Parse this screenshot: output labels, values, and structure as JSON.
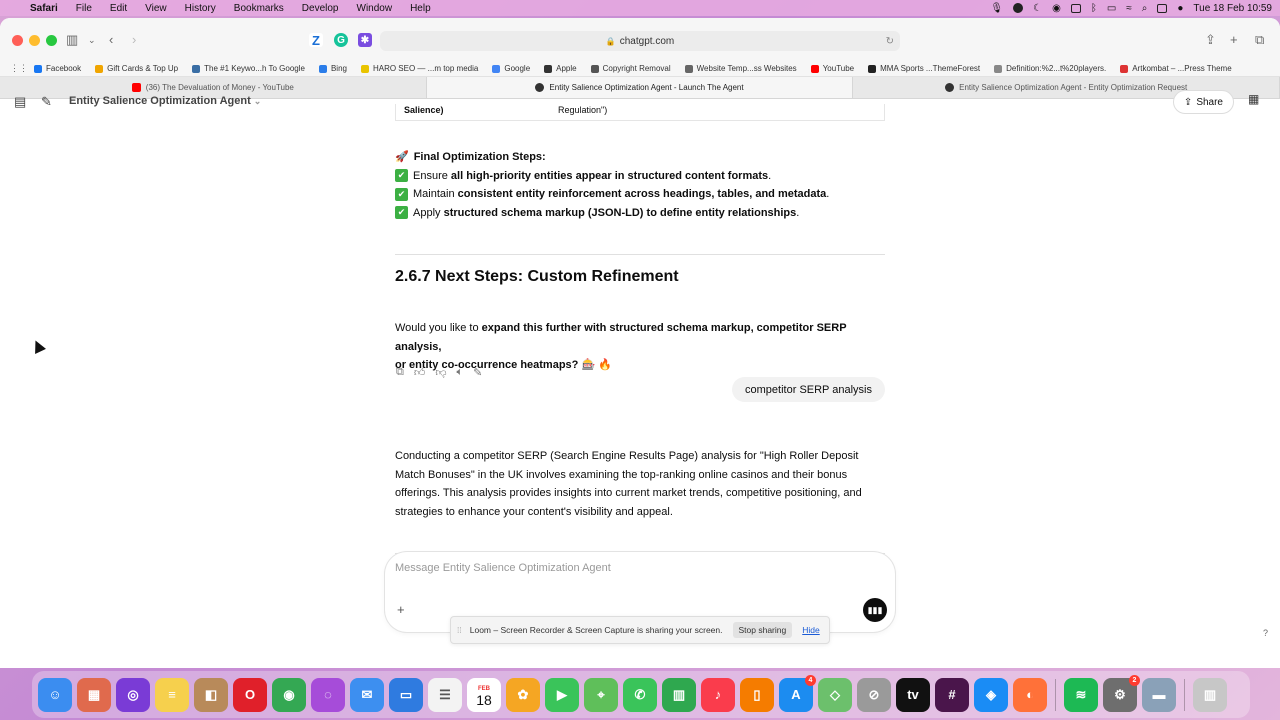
{
  "menubar": {
    "app": "Safari",
    "items": [
      "File",
      "Edit",
      "View",
      "History",
      "Bookmarks",
      "Develop",
      "Window",
      "Help"
    ],
    "clock": "Tue 18 Feb  10:59"
  },
  "browser": {
    "url": "chatgpt.com",
    "favorites": [
      {
        "label": "Facebook",
        "color": "#1877f2"
      },
      {
        "label": "Gift Cards & Top Up",
        "color": "#f0a500"
      },
      {
        "label": "The #1 Keywo...h To Google",
        "color": "#3a6ea5"
      },
      {
        "label": "Bing",
        "color": "#2b7de9"
      },
      {
        "label": "HARO SEO — ...m top media",
        "color": "#e9c400"
      },
      {
        "label": "Google",
        "color": "#4285f4"
      },
      {
        "label": "Apple",
        "color": "#333333"
      },
      {
        "label": "Copyright Removal",
        "color": "#555555"
      },
      {
        "label": "Website Temp...ss Websites",
        "color": "#666666"
      },
      {
        "label": "YouTube",
        "color": "#ff0000"
      },
      {
        "label": "MMA Sports ...ThemeForest",
        "color": "#222222"
      },
      {
        "label": "Definition:%2...t%20players.",
        "color": "#888888"
      },
      {
        "label": "Artkombat – ...Press Theme",
        "color": "#d33"
      }
    ],
    "tabs": [
      {
        "label": "(36) The Devaluation of Money - YouTube",
        "color": "#ff0000",
        "active": false
      },
      {
        "label": "Entity Salience Optimization Agent - Launch The Agent",
        "color": "#333333",
        "active": true
      },
      {
        "label": "Entity Salience Optimization Agent - Entity Optimization Request",
        "color": "#333333",
        "active": false
      }
    ]
  },
  "header": {
    "agent_title": "Entity Salience Optimization Agent",
    "share_label": "Share"
  },
  "conversation": {
    "table_row": {
      "col1": "Salience)",
      "col2": "Regulation\")"
    },
    "final_steps_title": "Final Optimization Steps:",
    "final_steps": [
      {
        "prefix": "Ensure ",
        "bold": "all high-priority entities appear in structured content formats",
        "suffix": "."
      },
      {
        "prefix": "Maintain ",
        "bold": "consistent entity reinforcement across headings, tables, and metadata",
        "suffix": "."
      },
      {
        "prefix": "Apply ",
        "bold": "structured schema markup (JSON-LD) to define entity relationships",
        "suffix": "."
      }
    ],
    "section_heading": "2.6.7 Next Steps: Custom Refinement",
    "question_prefix": "Would you like to ",
    "question_bold_1": "expand this further with structured schema markup, competitor SERP analysis,",
    "question_bold_2": "or entity co-occurrence heatmaps?",
    "question_emoji": "🎰 🔥",
    "user_message": "competitor SERP analysis",
    "reply": "Conducting a competitor SERP (Search Engine Results Page) analysis for \"High Roller Deposit Match Bonuses\" in the UK involves examining the top-ranking online casinos and their bonus offerings. This analysis provides insights into current market trends, competitive positioning, and strategies to enhance your content's visibility and appeal."
  },
  "composer": {
    "placeholder": "Message Entity Salience Optimization Agent"
  },
  "loom": {
    "message": "Loom – Screen Recorder & Screen Capture is sharing your screen.",
    "stop_label": "Stop sharing",
    "hide_label": "Hide"
  },
  "dock": {
    "calendar_month": "FEB",
    "calendar_day": "18",
    "apps": [
      {
        "name": "finder",
        "color": "#3b8df0"
      },
      {
        "name": "launchpad",
        "color": "#e06a4d"
      },
      {
        "name": "siri",
        "color": "#7a3bd6"
      },
      {
        "name": "notes",
        "color": "#f6d04d"
      },
      {
        "name": "bag",
        "color": "#b88a5a"
      },
      {
        "name": "opera",
        "color": "#e0202a"
      },
      {
        "name": "chrome",
        "color": "#34a853"
      },
      {
        "name": "podcasts",
        "color": "#a64cd9"
      },
      {
        "name": "mail",
        "color": "#3d8ff0"
      },
      {
        "name": "keynote",
        "color": "#2f7be0"
      },
      {
        "name": "reminders",
        "color": "#f3f3f3"
      },
      {
        "name": "calendar",
        "color": "#ffffff"
      },
      {
        "name": "photos",
        "color": "#f5a623"
      },
      {
        "name": "facetime",
        "color": "#3ac45a"
      },
      {
        "name": "maps",
        "color": "#5fbf5a"
      },
      {
        "name": "messages",
        "color": "#3ac45a"
      },
      {
        "name": "numbers",
        "color": "#2fa84f"
      },
      {
        "name": "music",
        "color": "#fa3c4c"
      },
      {
        "name": "books",
        "color": "#f57c00"
      },
      {
        "name": "app-store",
        "color": "#1c8cf0"
      },
      {
        "name": "maps2",
        "color": "#6cc06c"
      },
      {
        "name": "system",
        "color": "#9a9a9a"
      },
      {
        "name": "apple-tv",
        "color": "#111111"
      },
      {
        "name": "slack",
        "color": "#4a154b"
      },
      {
        "name": "safari",
        "color": "#1a8cf5"
      },
      {
        "name": "firefox",
        "color": "#ff7139"
      },
      {
        "name": "spotify",
        "color": "#1db954"
      },
      {
        "name": "settings",
        "color": "#6e6e6e"
      },
      {
        "name": "finder2",
        "color": "#8aa1b8"
      },
      {
        "name": "trash",
        "color": "#c7c7c7"
      }
    ]
  }
}
